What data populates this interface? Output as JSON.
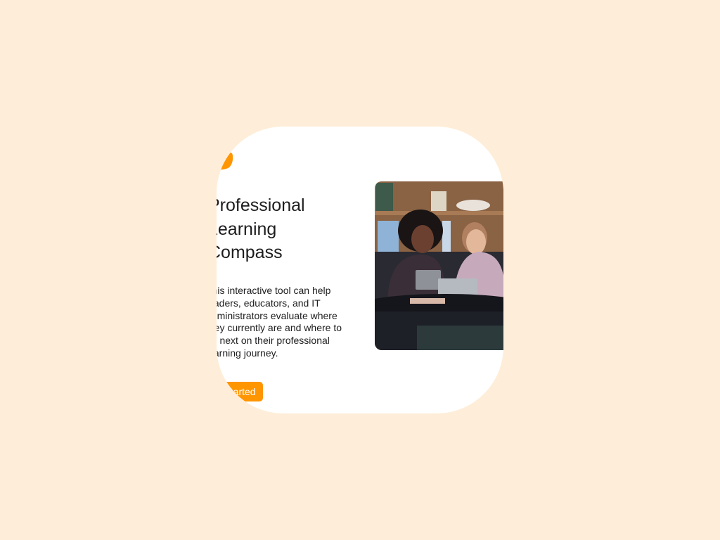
{
  "hero": {
    "title": "Professional Learning Compass",
    "description": "This interactive tool can help leaders, educators, and IT administrators evaluate where they currently are and where to go next on their professional learning journey.",
    "cta_label": "Get Started",
    "photo_alt": "Two educators using iPads at a library table"
  },
  "colors": {
    "accent": "#ff9500",
    "background": "#feeed9"
  }
}
